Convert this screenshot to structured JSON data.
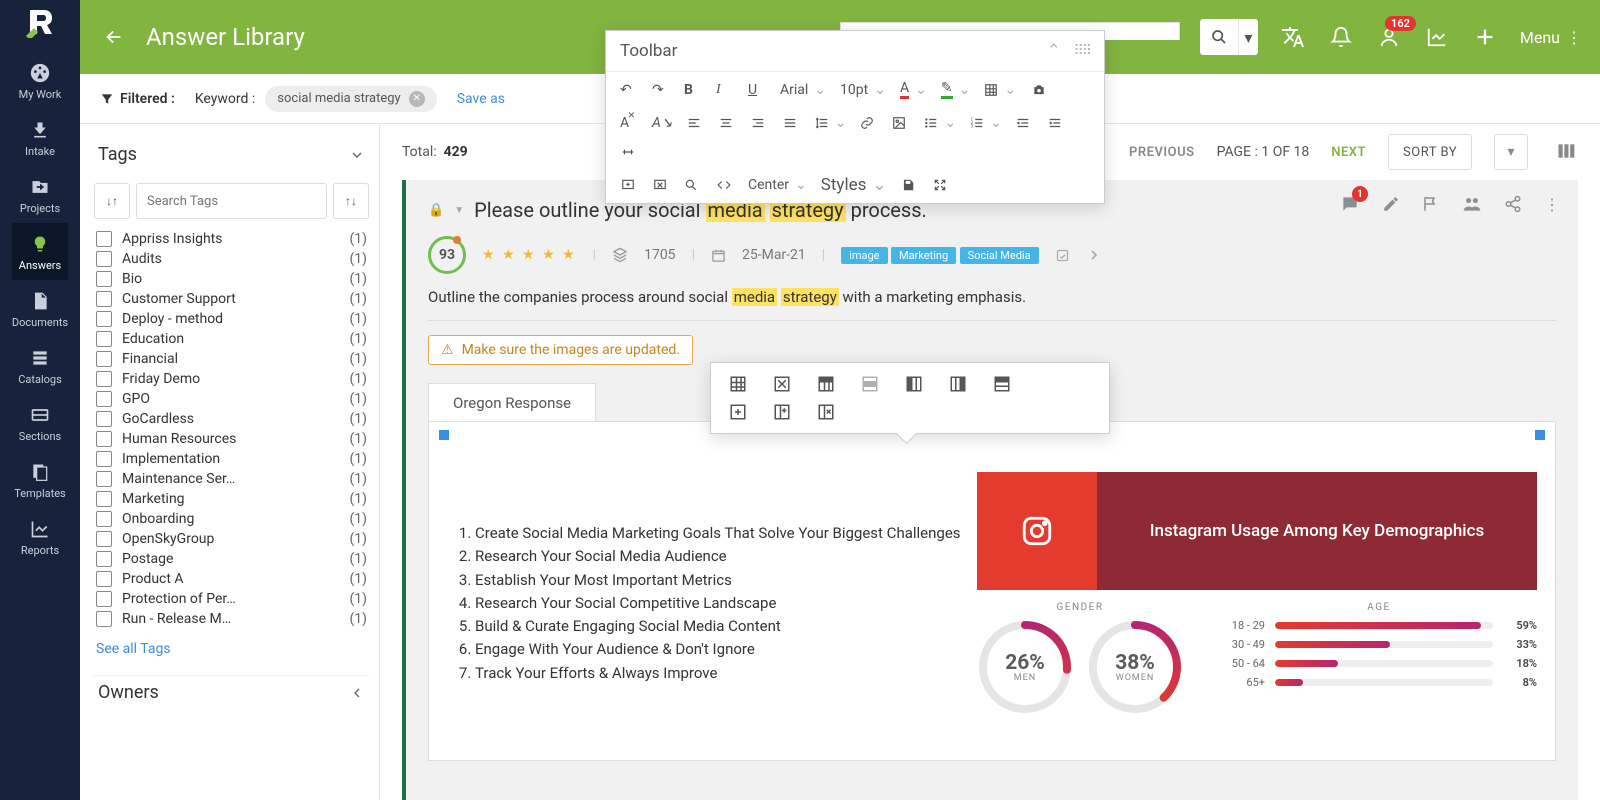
{
  "nav": {
    "items": [
      {
        "label": "My Work"
      },
      {
        "label": "Intake"
      },
      {
        "label": "Projects"
      },
      {
        "label": "Answers"
      },
      {
        "label": "Documents"
      },
      {
        "label": "Catalogs"
      },
      {
        "label": "Sections"
      },
      {
        "label": "Templates"
      },
      {
        "label": "Reports"
      }
    ]
  },
  "header": {
    "title": "Answer Library",
    "menu": "Menu",
    "user_badge": "162"
  },
  "filter": {
    "label": "Filtered :",
    "keyword_label": "Keyword :",
    "keyword_value": "social media strategy",
    "save_as": "Save as"
  },
  "sidebar": {
    "tags_label": "Tags",
    "search_placeholder": "Search Tags",
    "see_all": "See all Tags",
    "owners_label": "Owners",
    "tags": [
      {
        "label": "Appriss Insights",
        "count": "(1)"
      },
      {
        "label": "Audits",
        "count": "(1)"
      },
      {
        "label": "Bio",
        "count": "(1)"
      },
      {
        "label": "Customer Support",
        "count": "(1)"
      },
      {
        "label": "Deploy - method",
        "count": "(1)"
      },
      {
        "label": "Education",
        "count": "(1)"
      },
      {
        "label": "Financial",
        "count": "(1)"
      },
      {
        "label": "Friday Demo",
        "count": "(1)"
      },
      {
        "label": "GPO",
        "count": "(1)"
      },
      {
        "label": "GoCardless",
        "count": "(1)"
      },
      {
        "label": "Human Resources",
        "count": "(1)"
      },
      {
        "label": "Implementation",
        "count": "(1)"
      },
      {
        "label": "Maintenance Ser…",
        "count": "(1)"
      },
      {
        "label": "Marketing",
        "count": "(1)"
      },
      {
        "label": "Onboarding",
        "count": "(1)"
      },
      {
        "label": "OpenSkyGroup",
        "count": "(1)"
      },
      {
        "label": "Postage",
        "count": "(1)"
      },
      {
        "label": "Product A",
        "count": "(1)"
      },
      {
        "label": "Protection of Per…",
        "count": "(1)"
      },
      {
        "label": "Run - Release M…",
        "count": "(1)"
      }
    ]
  },
  "list": {
    "total_label": "Total:",
    "total": "429",
    "prev": "PREVIOUS",
    "page": "PAGE : 1 OF 18",
    "next": "NEXT",
    "sort": "SORT BY"
  },
  "card": {
    "question_pre": "Please outline your social ",
    "question_hl1": "media",
    "question_mid": " ",
    "question_hl2": "strategy",
    "question_post": " process.",
    "score": "93",
    "views": "1705",
    "date": "25-Mar-21",
    "tags": [
      "image",
      "Marketing",
      "Social Media"
    ],
    "sub_pre": "Outline the companies process around social ",
    "sub_hl1": "media",
    "sub_mid": " ",
    "sub_hl2": "strategy",
    "sub_post": " with a marketing emphasis.",
    "warning": "Make sure the images are updated.",
    "tab": "Oregon Response",
    "comment_badge": "1",
    "steps": [
      "Create Social Media Marketing Goals That Solve Your Biggest Challenges",
      "Research Your Social Media Audience",
      "Establish Your Most Important Metrics",
      "Research Your Social Competitive Landscape",
      "Build & Curate Engaging Social Media Content",
      "Engage With Your Audience & Don't Ignore",
      "Track Your Efforts & Always Improve"
    ],
    "infographic_title": "Instagram Usage Among Key Demographics"
  },
  "toolbar": {
    "title": "Toolbar",
    "font": "Arial",
    "size": "10pt",
    "center": "Center",
    "styles": "Styles"
  },
  "chart_data": {
    "gender_label": "GENDER",
    "age_label": "AGE",
    "donuts": [
      {
        "value": "26%",
        "label": "MEN",
        "pct": 26
      },
      {
        "value": "38%",
        "label": "WOMEN",
        "pct": 38
      }
    ],
    "age_bars": [
      {
        "label": "18 - 29",
        "pct": 59,
        "disp": "59%"
      },
      {
        "label": "30 - 49",
        "pct": 33,
        "disp": "33%"
      },
      {
        "label": "50 - 64",
        "pct": 18,
        "disp": "18%"
      },
      {
        "label": "65+",
        "pct": 8,
        "disp": "8%"
      }
    ]
  }
}
